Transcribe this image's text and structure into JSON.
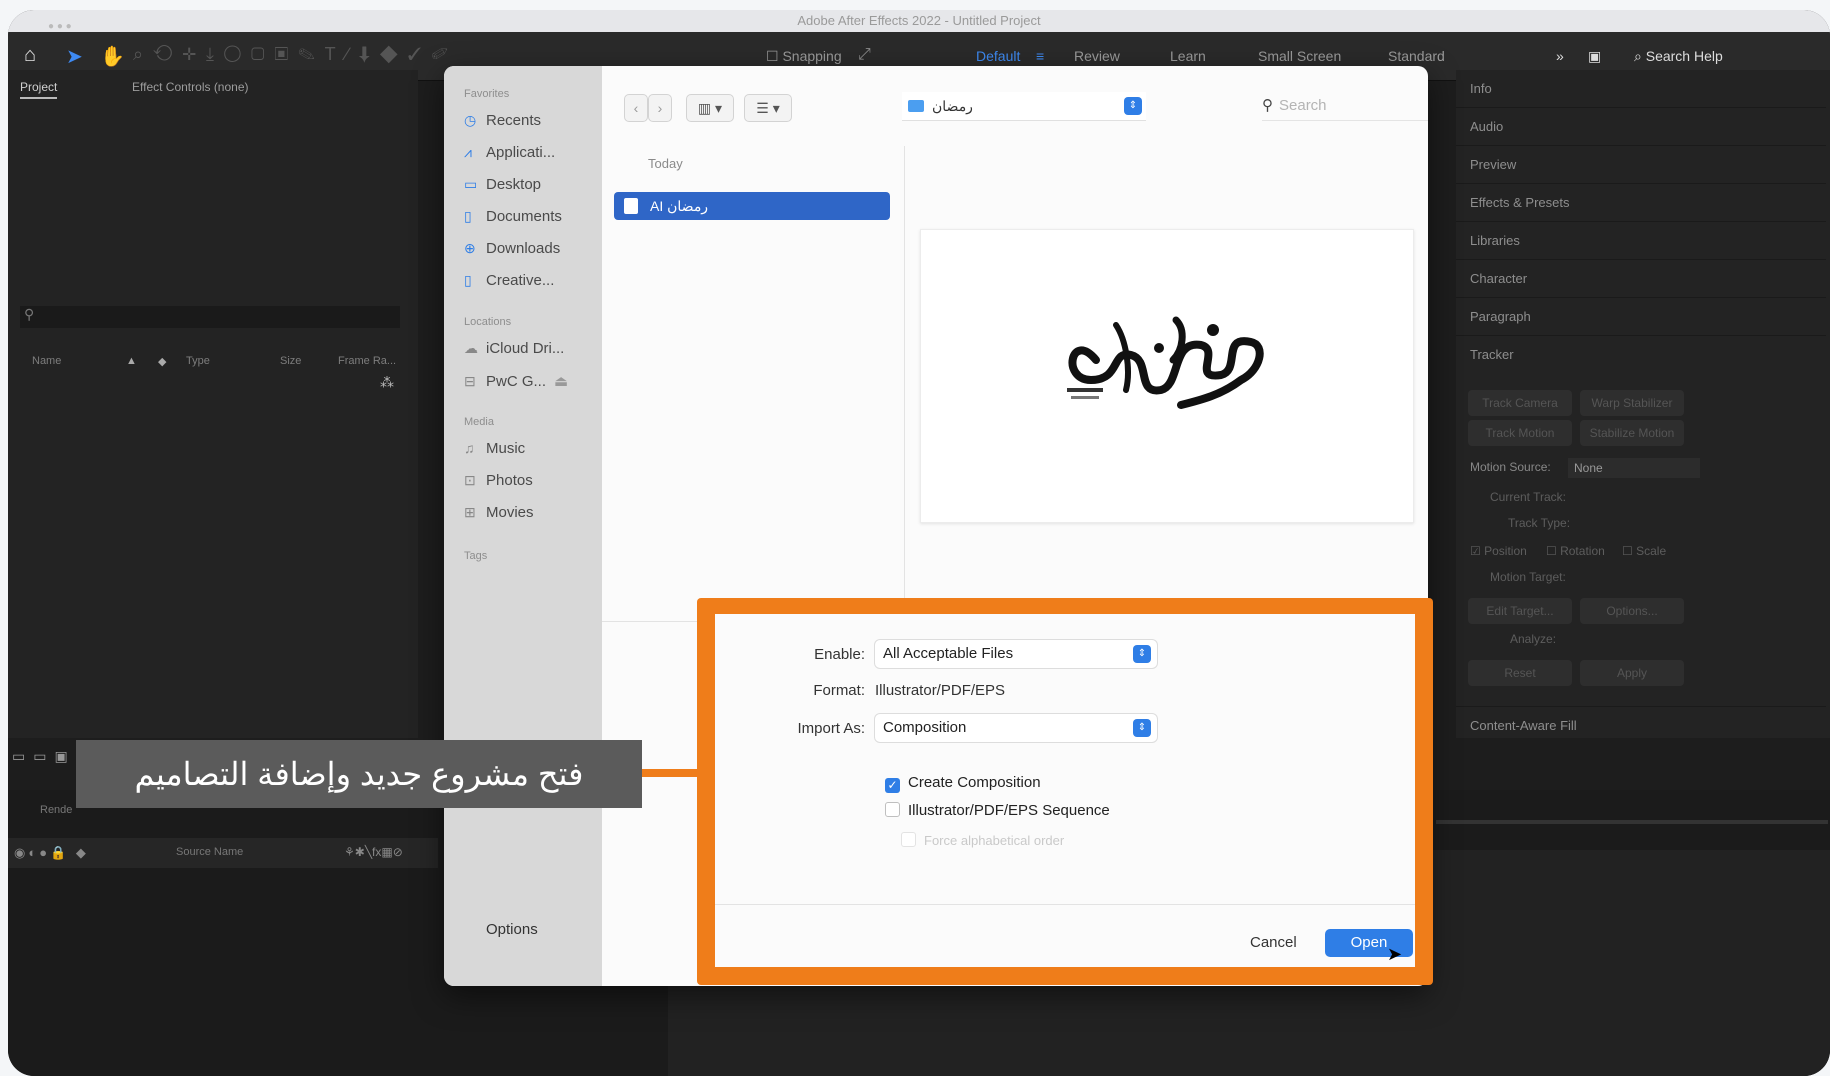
{
  "app": {
    "title": "Adobe After Effects 2022 - Untitled Project",
    "workspaces": [
      "Snapping",
      "Default",
      "Review",
      "Learn",
      "Small Screen",
      "Standard"
    ],
    "active_workspace": "Default",
    "search_help": "Search Help",
    "accent": "#3e8af2"
  },
  "project_panel": {
    "tabs": [
      "Project",
      "Effect Controls (none)"
    ],
    "columns": [
      "Name",
      "Type",
      "Size",
      "Frame Ra..."
    ]
  },
  "right_panels": [
    "Info",
    "Audio",
    "Preview",
    "Effects & Presets",
    "Libraries",
    "Character",
    "Paragraph",
    "Tracker",
    "Content-Aware Fill"
  ],
  "tracker": {
    "buttons": [
      "Track Camera",
      "Warp Stabilizer",
      "Track Motion",
      "Stabilize Motion"
    ],
    "motion_source_label": "Motion Source:",
    "motion_source_value": "None",
    "current_track": "Current Track:",
    "track_type": "Track Type:",
    "checkboxes": [
      "Position",
      "Rotation",
      "Scale"
    ],
    "motion_target": "Motion Target:",
    "edit_target": "Edit Target...",
    "options": "Options...",
    "analyze": "Analyze:",
    "reset": "Reset",
    "apply": "Apply"
  },
  "timeline": {
    "source_name": "Source Name",
    "render": "Rende"
  },
  "dialog": {
    "sidebar": {
      "favorites_header": "Favorites",
      "favorites": [
        "Recents",
        "Applicati...",
        "Desktop",
        "Documents",
        "Downloads",
        "Creative..."
      ],
      "locations_header": "Locations",
      "locations": [
        "iCloud Dri...",
        "PwC G..."
      ],
      "media_header": "Media",
      "media": [
        "Music",
        "Photos",
        "Movies"
      ],
      "tags_header": "Tags"
    },
    "folder": "رمضان",
    "search_placeholder": "Search",
    "date_group": "Today",
    "selected_file": "AI رمضان",
    "enable_label": "Enable:",
    "enable_value": "All Acceptable Files",
    "format_label": "Format:",
    "format_value": "Illustrator/PDF/EPS",
    "import_as_label": "Import As:",
    "import_as_value": "Composition",
    "create_composition": "Create Composition",
    "sequence": "Illustrator/PDF/EPS Sequence",
    "force_alpha": "Force alphabetical order",
    "options_button": "Options",
    "cancel_button": "Cancel",
    "open_button": "Open",
    "highlight_color": "#ef7d1a"
  },
  "caption": "فتح مشروع جديد وإضافة التصاميم"
}
